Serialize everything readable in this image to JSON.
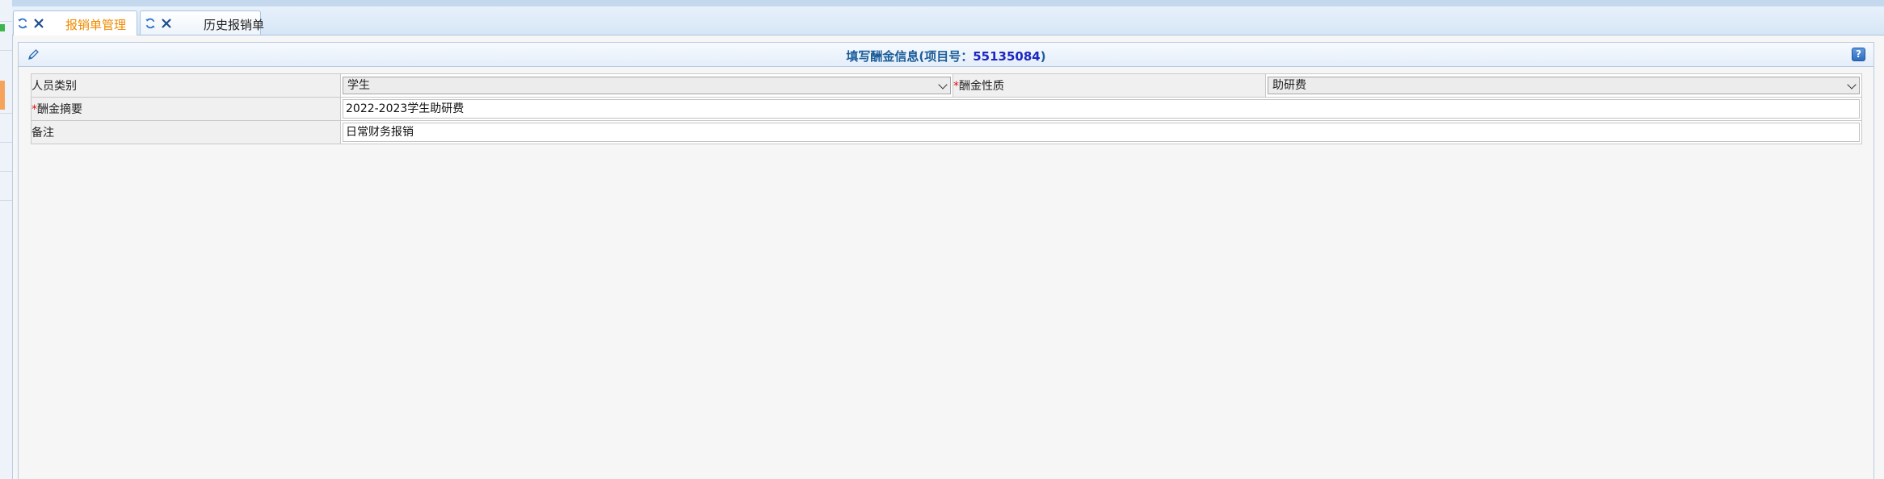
{
  "tabs": [
    {
      "label": "报销单管理",
      "active": true,
      "icons": [
        "refresh-icon",
        "close-icon"
      ]
    },
    {
      "label": "历史报销单",
      "active": false,
      "icons": [
        "refresh-icon",
        "close-icon"
      ]
    }
  ],
  "panel": {
    "title_prefix": "填写酬金信息(项目号：",
    "project_no": "55135084",
    "title_suffix": ")",
    "help_label": "?",
    "edit_icon": "pencil-icon"
  },
  "form": {
    "required_mark": "*",
    "person_type": {
      "label": "人员类别",
      "value": "学生"
    },
    "pay_nature": {
      "label": "酬金性质",
      "value": "助研费"
    },
    "pay_summary": {
      "label": "酬金摘要",
      "value": "2022-2023学生助研费"
    },
    "remark": {
      "label": "备注",
      "value": "日常财务报销"
    }
  },
  "colors": {
    "active_tab": "#ef8a00",
    "title": "#1b5d99",
    "project_no": "#1d27c2",
    "required": "#e01010"
  }
}
